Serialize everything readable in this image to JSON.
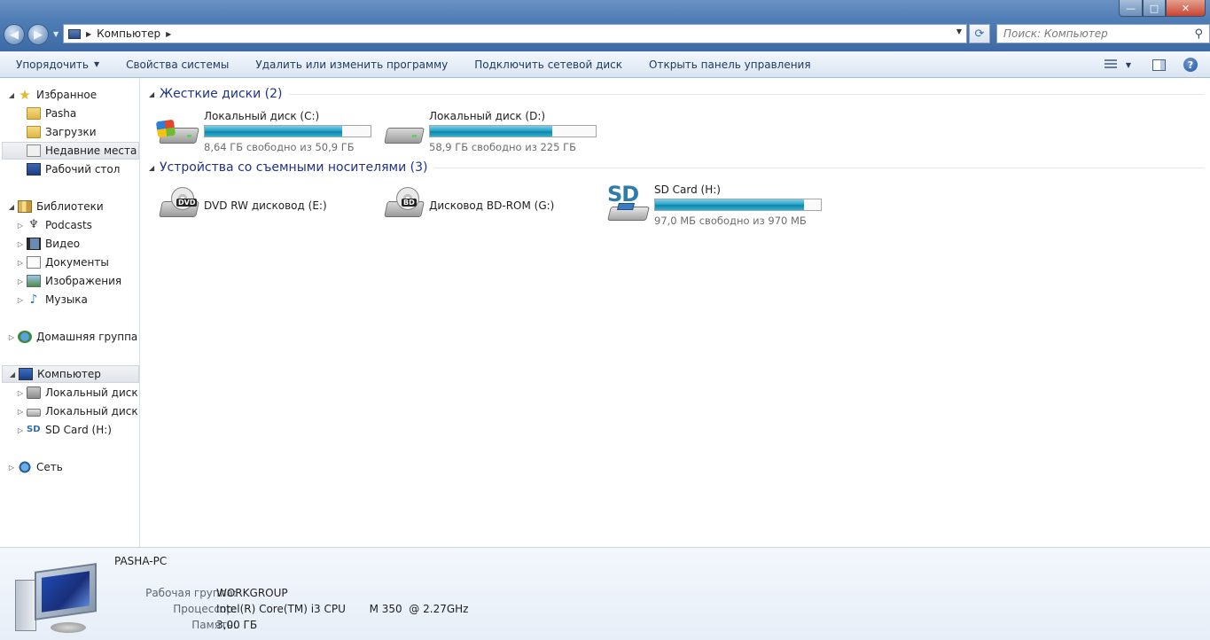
{
  "window": {
    "minimize_glyph": "—",
    "maximize_glyph": "□",
    "close_glyph": "✕"
  },
  "nav": {
    "back_glyph": "◀",
    "forward_glyph": "▶"
  },
  "address": {
    "segments": [
      "Компьютер"
    ],
    "separator_glyph": "▶",
    "dropdown_glyph": "▼",
    "refresh_glyph": "⟳"
  },
  "search": {
    "placeholder": "Поиск: Компьютер"
  },
  "toolbar": {
    "organize": "Упорядочить",
    "system_properties": "Свойства системы",
    "uninstall": "Удалить или изменить программу",
    "map_drive": "Подключить сетевой диск",
    "control_panel": "Открыть панель управления",
    "caret_glyph": "▼",
    "help_glyph": "?"
  },
  "sidebar": {
    "favorites": {
      "label": "Избранное",
      "items": [
        "Pasha",
        "Загрузки",
        "Недавние места",
        "Рабочий стол"
      ]
    },
    "libraries": {
      "label": "Библиотеки",
      "items": [
        "Podcasts",
        "Видео",
        "Документы",
        "Изображения",
        "Музыка"
      ]
    },
    "homegroup": {
      "label": "Домашняя группа"
    },
    "computer": {
      "label": "Компьютер",
      "items": [
        "Локальный диск (C",
        "Локальный диск (D",
        "SD Card (H:)"
      ]
    },
    "network": {
      "label": "Сеть"
    },
    "expanded_glyph": "◢",
    "collapsed_glyph": "▷"
  },
  "groups": {
    "hard_disks": {
      "title": "Жесткие диски (2)",
      "drives": [
        {
          "name": "Локальный диск (C:)",
          "free_text": "8,64 ГБ свободно из 50,9 ГБ",
          "used_fraction": 0.83
        },
        {
          "name": "Локальный диск (D:)",
          "free_text": "58,9 ГБ свободно из 225 ГБ",
          "used_fraction": 0.74
        }
      ]
    },
    "removable": {
      "title": "Устройства со съемными носителями (3)",
      "drives": [
        {
          "name": "DVD RW дисковод (E:)",
          "disc_label": "DVD"
        },
        {
          "name": "Дисковод BD-ROM (G:)",
          "disc_label": "BD"
        },
        {
          "name": "SD Card (H:)",
          "free_text": "97,0 МБ свободно из 970 МБ",
          "used_fraction": 0.9,
          "icon_text": "SD"
        }
      ]
    },
    "collapse_glyph": "◢"
  },
  "details": {
    "computer_name": "PASHA-PC",
    "workgroup_label": "Рабочая группа:",
    "workgroup_value": "WORKGROUP",
    "cpu_label": "Процессор:",
    "cpu_value": "Intel(R) Core(TM) i3 CPU       M 350  @ 2.27GHz",
    "memory_label": "Память:",
    "memory_value": "3,00 ГБ"
  },
  "colors": {
    "group_title": "#1e3287",
    "capacity_fill": "#27a6c9",
    "titlebar": "#4f7db5"
  }
}
